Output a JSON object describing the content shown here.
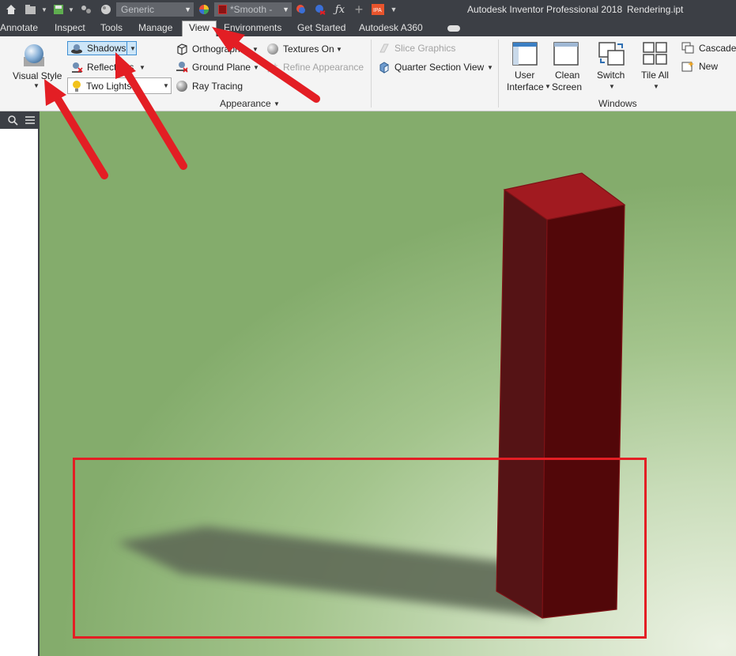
{
  "qat": {
    "material": "Generic",
    "appearance": "*Smooth -",
    "app_title": "Autodesk Inventor Professional 2018",
    "document": "Rendering.ipt"
  },
  "tabs": [
    "Annotate",
    "Inspect",
    "Tools",
    "Manage",
    "View",
    "Environments",
    "Get Started",
    "Autodesk A360"
  ],
  "active_tab": "View",
  "ribbon": {
    "visual_style": "Visual Style",
    "shadows": "Shadows",
    "reflections": "Reflections",
    "lighting": "Two Lights",
    "orthographic": "Orthographic",
    "ground_plane": "Ground Plane",
    "ray_tracing": "Ray Tracing",
    "textures_on": "Textures On",
    "refine_appearance": "Refine Appearance",
    "slice_graphics": "Slice Graphics",
    "quarter_section": "Quarter Section View",
    "user_interface_1": "User",
    "user_interface_2": "Interface",
    "clean_screen_1": "Clean",
    "clean_screen_2": "Screen",
    "switch": "Switch",
    "tile_all": "Tile All",
    "cascade": "Cascade",
    "new": "New",
    "panel_appearance": "Appearance",
    "panel_windows": "Windows"
  },
  "colors": {
    "annotation_red": "#e31e24",
    "bar_dark": "#3c3f45",
    "selection_blue": "#cde6f8"
  }
}
